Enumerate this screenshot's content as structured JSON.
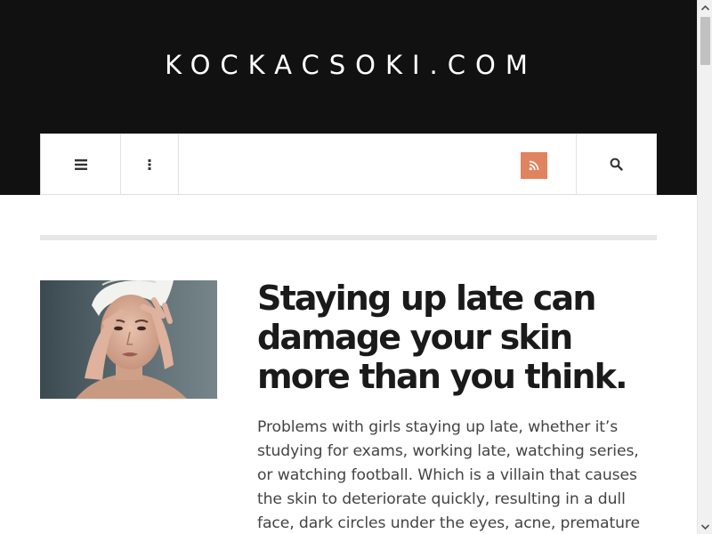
{
  "site": {
    "title": "KOCKACSOKI.COM"
  },
  "nav": {
    "menu_icon": "hamburger-menu-icon",
    "more_icon": "vertical-dots-icon",
    "rss_icon": "rss-feed-icon",
    "search_icon": "search-icon",
    "rss_color": "#e0835f"
  },
  "article": {
    "title": "Staying up late can damage your skin more than you think.",
    "excerpt": "Problems with girls staying up late, whether it’s studying for exams, working late, watching series, or watching football. Which is a villain that causes the skin to deteriorate quickly, resulting in a dull face, dark circles under the eyes, acne, premature wrinkles on"
  },
  "colors": {
    "header_bg": "#111111",
    "divider": "#e6e6e6",
    "headline": "#1a1a1a",
    "body_text": "#444444"
  }
}
